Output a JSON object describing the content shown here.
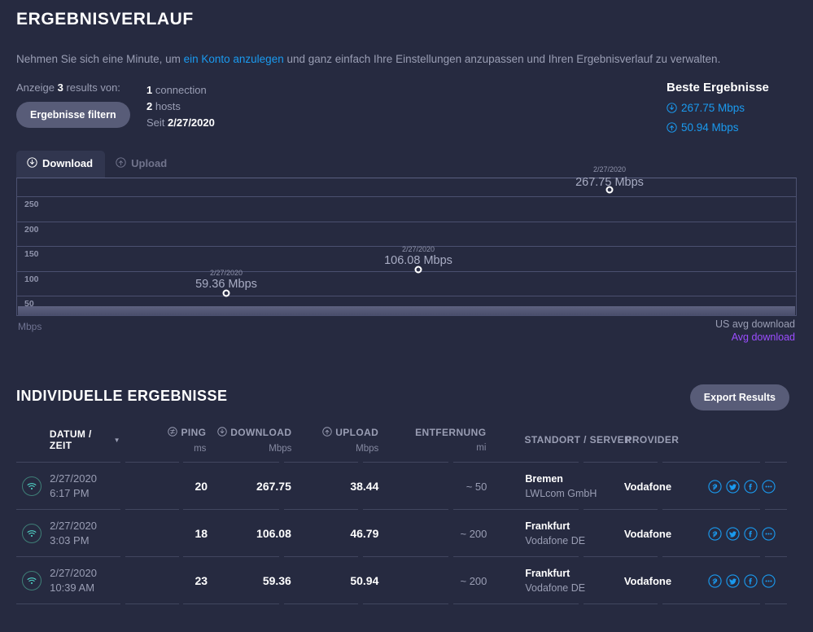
{
  "header": {
    "title": "ERGEBNISVERLAUF",
    "intro_before": "Nehmen Sie sich eine Minute, um ",
    "intro_link": "ein Konto anzulegen",
    "intro_after": " und ganz einfach Ihre Einstellungen anzupassen und Ihren Ergebnisverlauf zu verwalten.",
    "count_prefix": "Anzeige ",
    "count_value": "3",
    "count_suffix": " results von:",
    "filter_button": "Ergebnisse filtern",
    "connections_value": "1",
    "connections_label": " connection",
    "hosts_value": "2",
    "hosts_label": " hosts",
    "since_label": "Seit ",
    "since_value": "2/27/2020"
  },
  "best": {
    "title": "Beste Ergebnisse",
    "download": "267.75 Mbps",
    "upload": "50.94 Mbps",
    "download_icon": "download-circle-icon",
    "upload_icon": "upload-circle-icon",
    "accent": "#1a9aef"
  },
  "tabs": [
    {
      "label": "Download",
      "icon": "download-circle-icon",
      "active": true
    },
    {
      "label": "Upload",
      "icon": "upload-circle-icon",
      "active": false
    }
  ],
  "chart_data": {
    "type": "line",
    "title": "",
    "xlabel": "",
    "ylabel": "Mbps",
    "ylim": [
      0,
      300
    ],
    "grid": true,
    "yticks": [
      250,
      200,
      150,
      100,
      50
    ],
    "x": [
      "2/27/2020",
      "2/27/2020",
      "2/27/2020"
    ],
    "point_dates": [
      "2/27/2020",
      "2/27/2020",
      "2/27/2020"
    ],
    "point_labels": [
      "59.36 Mbps",
      "106.08 Mbps",
      "267.75 Mbps"
    ],
    "values": [
      59.36,
      106.08,
      267.75
    ],
    "series": [
      {
        "name": "Avg download",
        "values": [
          59.36,
          106.08,
          267.75
        ],
        "color": "#9b4dff"
      }
    ],
    "legend": [
      "US avg download",
      "Avg download"
    ],
    "legend_position": "bottom-right",
    "us_avg_band_label": "US avg download"
  },
  "chart_legend": {
    "us_avg": "US avg download",
    "avg": "Avg download",
    "avg_color": "#9b4dff",
    "unit": "Mbps"
  },
  "results": {
    "section_title": "INDIVIDUELLE ERGEBNISSE",
    "export_button": "Export Results",
    "columns": [
      {
        "label": "DATUM / ZEIT",
        "unit": "",
        "icon": "",
        "sorted": true
      },
      {
        "label": "PING",
        "unit": "ms",
        "icon": "ping-circle-icon"
      },
      {
        "label": "DOWNLOAD",
        "unit": "Mbps",
        "icon": "download-circle-icon"
      },
      {
        "label": "UPLOAD",
        "unit": "Mbps",
        "icon": "upload-circle-icon"
      },
      {
        "label": "ENTFERNUNG",
        "unit": "mi",
        "icon": ""
      },
      {
        "label": "STANDORT / SERVER",
        "unit": "",
        "icon": ""
      },
      {
        "label": "PROVIDER",
        "unit": "",
        "icon": ""
      }
    ],
    "rows": [
      {
        "connection_icon": "wifi-icon",
        "date": "2/27/2020",
        "time": "6:17 PM",
        "ping": "20",
        "download": "267.75",
        "upload": "38.44",
        "distance": "~ 50",
        "location": "Bremen",
        "server": "LWLcom GmbH",
        "provider": "Vodafone"
      },
      {
        "connection_icon": "wifi-icon",
        "date": "2/27/2020",
        "time": "3:03 PM",
        "ping": "18",
        "download": "106.08",
        "upload": "46.79",
        "distance": "~ 200",
        "location": "Frankfurt",
        "server": "Vodafone DE",
        "provider": "Vodafone"
      },
      {
        "connection_icon": "wifi-icon",
        "date": "2/27/2020",
        "time": "10:39 AM",
        "ping": "23",
        "download": "59.36",
        "upload": "50.94",
        "distance": "~ 200",
        "location": "Frankfurt",
        "server": "Vodafone DE",
        "provider": "Vodafone"
      }
    ],
    "share_icons": [
      "link-icon",
      "twitter-icon",
      "facebook-icon",
      "more-icon"
    ]
  }
}
